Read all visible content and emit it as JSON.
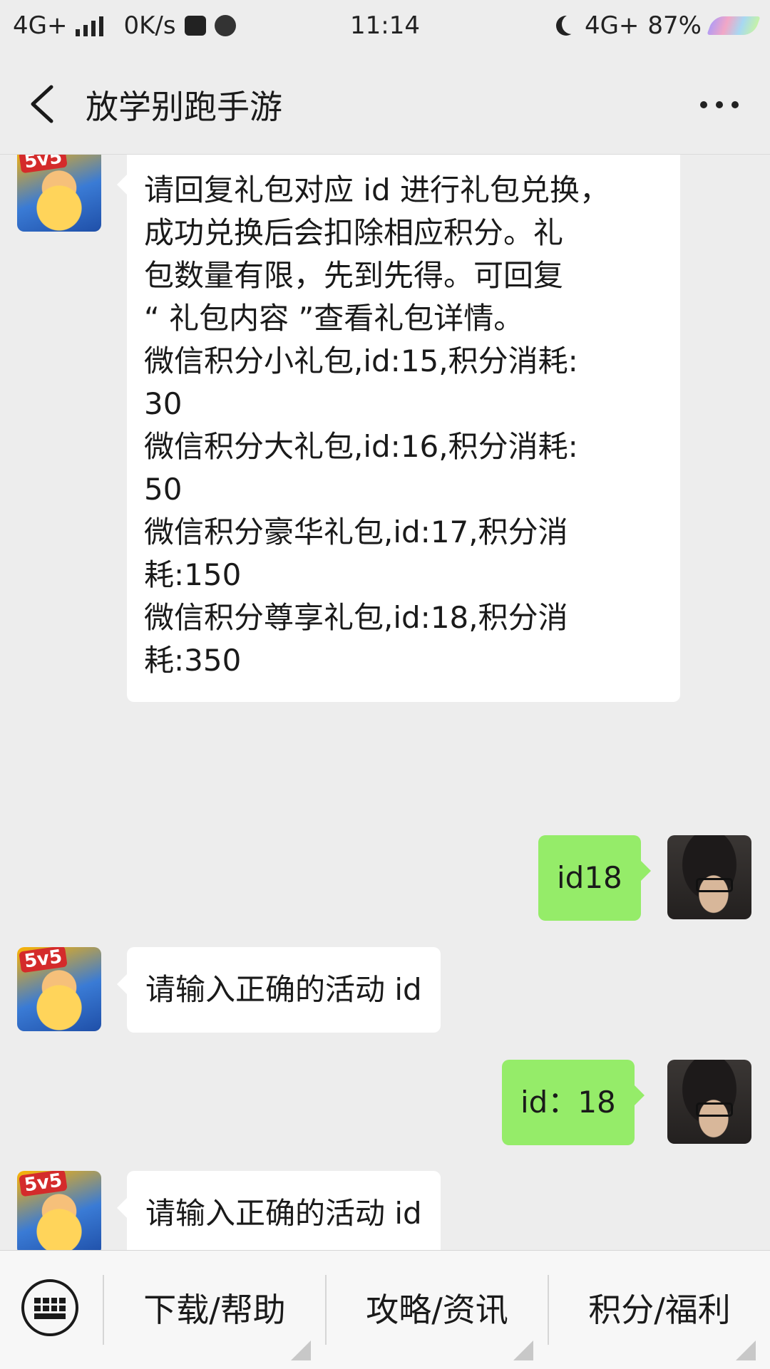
{
  "status_bar": {
    "network": "4G+",
    "speed": "0K/s",
    "time": "11:14",
    "network_right": "4G+",
    "battery": "87%"
  },
  "header": {
    "title": "放学别跑手游"
  },
  "messages": [
    {
      "side": "left",
      "lines": [
        "请回复礼包对应 id 进行礼包兑换，",
        "成功兑换后会扣除相应积分。礼",
        "包数量有限，先到先得。可回复",
        "“ 礼包内容 ”查看礼包详情。",
        "微信积分小礼包,id:15,积分消耗:",
        "30",
        "微信积分大礼包,id:16,积分消耗:",
        "50",
        "微信积分豪华礼包,id:17,积分消",
        "耗:150",
        "微信积分尊享礼包,id:18,积分消",
        "耗:350"
      ]
    },
    {
      "side": "right",
      "text": "id18"
    },
    {
      "side": "left",
      "text": "请输入正确的活动 id"
    },
    {
      "side": "right",
      "text": "id：18"
    },
    {
      "side": "left",
      "text": "请输入正确的活动 id"
    }
  ],
  "avatar_tag": "5v5",
  "bottom_menu": {
    "items": [
      "下载/帮助",
      "攻略/资讯",
      "积分/福利"
    ]
  }
}
